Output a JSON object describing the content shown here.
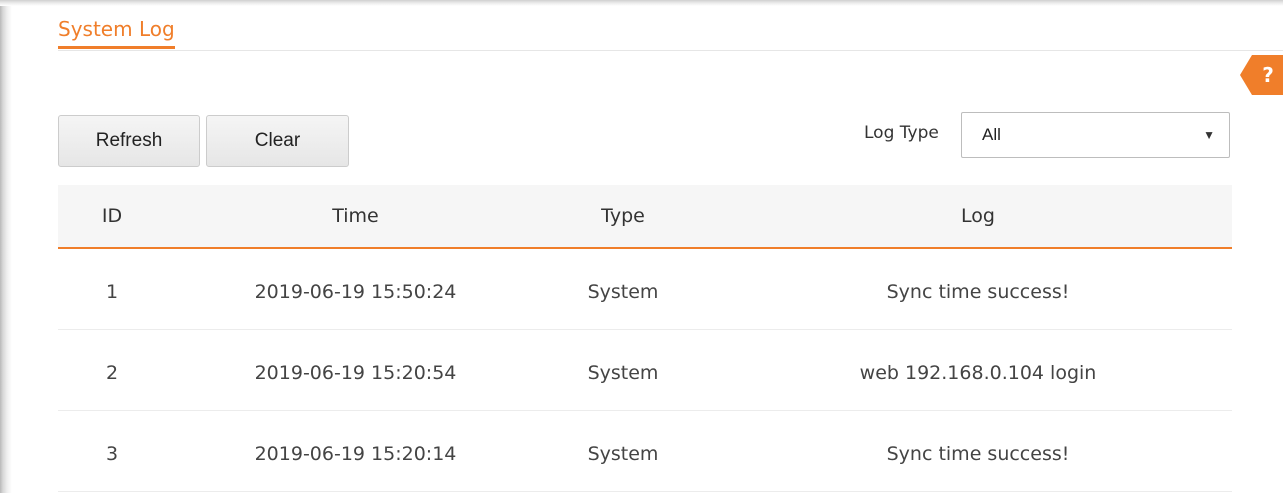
{
  "header": {
    "title": "System Log"
  },
  "help": {
    "glyph": "?",
    "icon": "question-mark-icon",
    "color": "#f07e2a"
  },
  "toolbar": {
    "refresh_label": "Refresh",
    "clear_label": "Clear"
  },
  "filter": {
    "label": "Log Type",
    "selected": "All",
    "arrow_icon": "caret-down-icon"
  },
  "table": {
    "columns": [
      "ID",
      "Time",
      "Type",
      "Log"
    ],
    "rows": [
      {
        "id": "1",
        "time": "2019-06-19 15:50:24",
        "type": "System",
        "log": "Sync time success!"
      },
      {
        "id": "2",
        "time": "2019-06-19 15:20:54",
        "type": "System",
        "log": "web 192.168.0.104 login"
      },
      {
        "id": "3",
        "time": "2019-06-19 15:20:14",
        "type": "System",
        "log": "Sync time success!"
      }
    ]
  },
  "colors": {
    "accent": "#f07e2a",
    "header_background": "#f6f6f6"
  }
}
